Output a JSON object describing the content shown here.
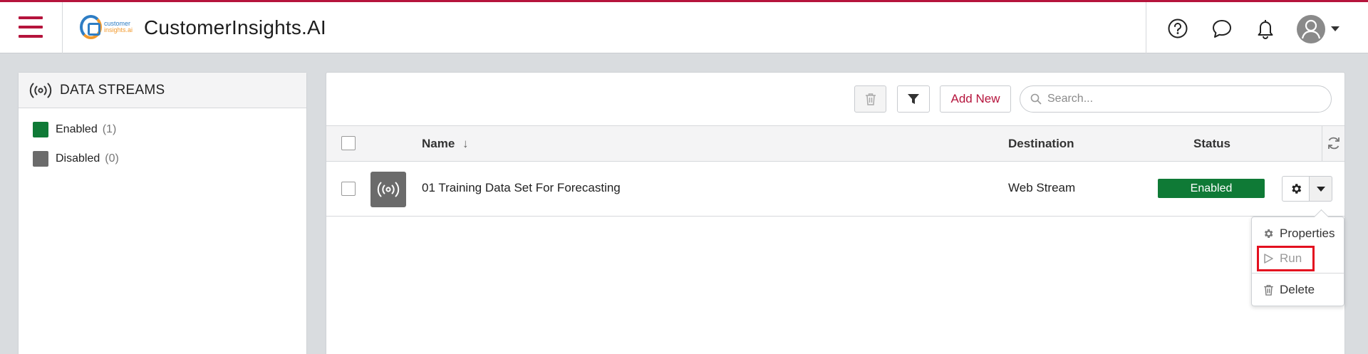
{
  "header": {
    "app_title": "CustomerInsights.AI",
    "logo": {
      "line1": "customer",
      "line2": "insights.ai"
    },
    "brand_color": "#b5143c",
    "icons": [
      "hamburger-menu-icon",
      "help-icon",
      "chat-icon",
      "bell-icon",
      "user-avatar-icon",
      "chevron-down-icon"
    ]
  },
  "left_panel": {
    "title": "DATA STREAMS",
    "icon": "broadcast-icon",
    "filters": [
      {
        "label": "Enabled",
        "count": "(1)",
        "color": "#0f7a36"
      },
      {
        "label": "Disabled",
        "count": "(0)",
        "color": "#6b6b6b"
      }
    ]
  },
  "toolbar": {
    "delete_icon": "trash-icon",
    "filter_icon": "filter-icon",
    "add_new_label": "Add New",
    "search_placeholder": "Search..."
  },
  "table": {
    "columns": {
      "name": "Name",
      "destination": "Destination",
      "status": "Status"
    },
    "sort_indicator": "↓",
    "rows": [
      {
        "name": "01 Training Data Set For Forecasting",
        "destination": "Web Stream",
        "status": "Enabled",
        "status_color": "#0f7a36",
        "icon": "broadcast-icon"
      }
    ]
  },
  "row_menu": {
    "items": [
      {
        "label": "Properties",
        "icon": "gear-icon",
        "enabled": true
      },
      {
        "label": "Run",
        "icon": "play-icon",
        "enabled": false
      },
      {
        "label": "Delete",
        "icon": "trash-icon",
        "enabled": true
      }
    ],
    "highlight_color": "#e3101f"
  }
}
